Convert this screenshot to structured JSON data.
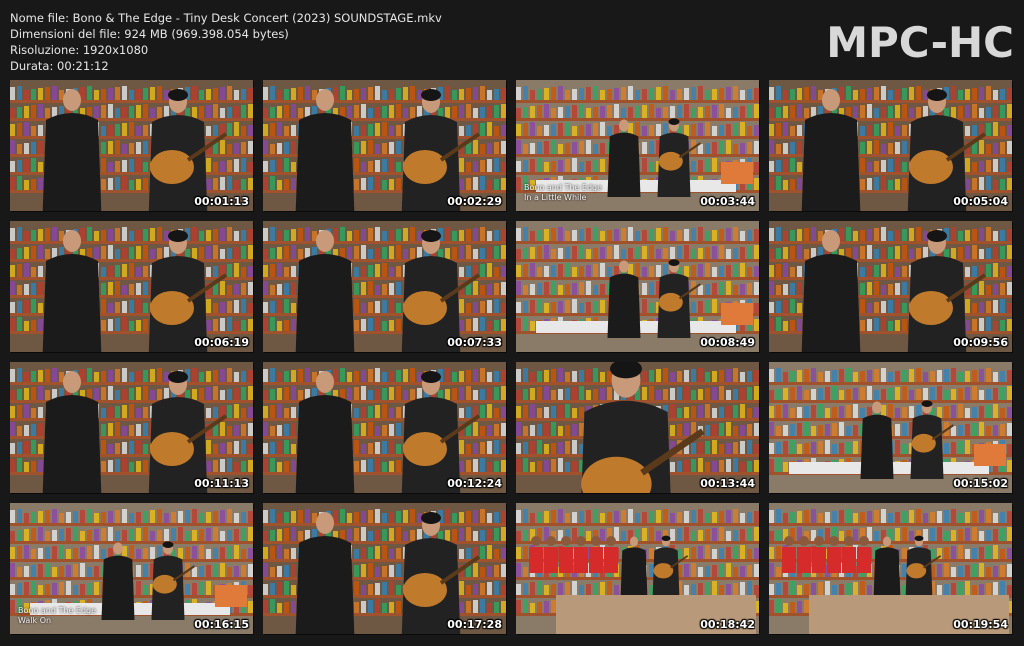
{
  "info": {
    "filename": "Nome file: Bono & The Edge - Tiny Desk Concert (2023) SOUNDSTAGE.mkv",
    "size": "Dimensioni del file: 924 MB (969.398.054 bytes)",
    "resolution": "Risoluzione: 1920x1080",
    "duration": "Durata: 00:21:12"
  },
  "logo": "MPC-HC",
  "thumbnails": [
    {
      "time": "00:01:13",
      "scene": "duo"
    },
    {
      "time": "00:02:29",
      "scene": "duo"
    },
    {
      "time": "00:03:44",
      "scene": "wide",
      "caption_1": "Bono and The Edge",
      "caption_2": "In a Little While"
    },
    {
      "time": "00:05:04",
      "scene": "duo"
    },
    {
      "time": "00:06:19",
      "scene": "duo"
    },
    {
      "time": "00:07:33",
      "scene": "duo"
    },
    {
      "time": "00:08:49",
      "scene": "wide"
    },
    {
      "time": "00:09:56",
      "scene": "duo"
    },
    {
      "time": "00:11:13",
      "scene": "duo"
    },
    {
      "time": "00:12:24",
      "scene": "duo"
    },
    {
      "time": "00:13:44",
      "scene": "closeup"
    },
    {
      "time": "00:15:02",
      "scene": "wide"
    },
    {
      "time": "00:16:15",
      "scene": "wide",
      "caption_1": "Bono and The Edge",
      "caption_2": "Walk On"
    },
    {
      "time": "00:17:28",
      "scene": "duo"
    },
    {
      "time": "00:18:42",
      "scene": "choir"
    },
    {
      "time": "00:19:54",
      "scene": "choir"
    }
  ]
}
